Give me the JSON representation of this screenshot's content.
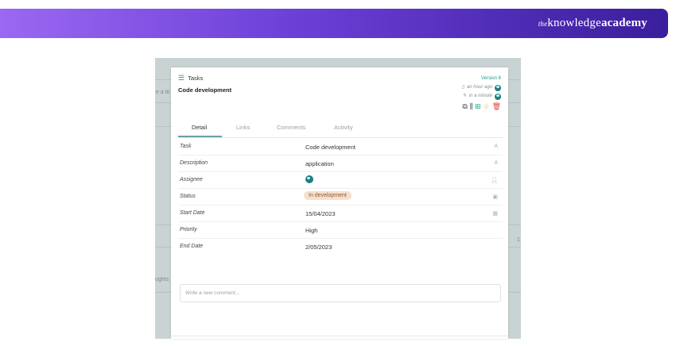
{
  "brand": {
    "prefix": "the",
    "mid": "knowledge",
    "bold": "academy"
  },
  "background": {
    "frag1": "e a tit",
    "frag2": "ughts",
    "frag3": "1"
  },
  "modal": {
    "section": "Tasks",
    "title": "Code development",
    "version": "Version 6",
    "created": "an hour ago",
    "edited": "in a minute",
    "tabs": [
      "Detail",
      "Links",
      "Comments",
      "Activity"
    ],
    "fields": [
      {
        "label": "Task",
        "value": "Code development",
        "icon": "text-icon"
      },
      {
        "label": "Description",
        "value": "application",
        "icon": "text-icon"
      },
      {
        "label": "Assignee",
        "value": "",
        "icon": "person-icon"
      },
      {
        "label": "Status",
        "value": "In development",
        "icon": "select-icon"
      },
      {
        "label": "Start Date",
        "value": "15/04/2023",
        "icon": "calendar-icon"
      },
      {
        "label": "Priority",
        "value": "High",
        "icon": ""
      },
      {
        "label": "End Date",
        "value": "2/05/2023",
        "icon": ""
      }
    ],
    "comment_placeholder": "Write a new comment...",
    "colors": {
      "accent": "#1aa08a",
      "status_bg": "#f6e0cc",
      "star": "#f0a01a",
      "delete": "#e0473a"
    }
  }
}
